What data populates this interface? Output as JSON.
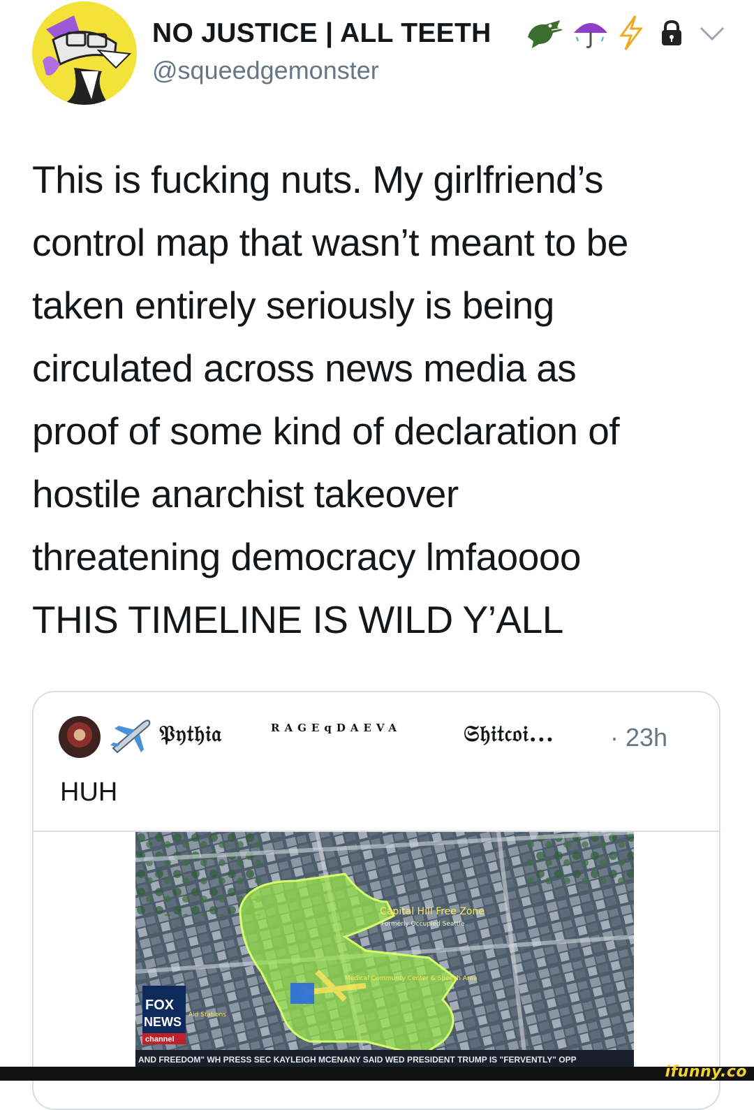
{
  "header": {
    "display_name": "NO JUSTICE | ALL TEETH",
    "name_emojis": [
      "crocodile-emoji",
      "umbrella-emoji",
      "lightning-emoji"
    ],
    "handle": "@squeedgemonster",
    "icons": [
      "lock-icon",
      "chevron-down-icon"
    ]
  },
  "tweet": {
    "text": "This is fucking nuts. My girlfriend’s\ncontrol map that wasn’t meant to be\ntaken entirely seriously is being\ncirculated across news media as\nproof of some kind of declaration of\nhostile anarchist takeover\nthreatening democracy lmfaoooo\nTHIS TIMELINE IS WILD Y’ALL"
  },
  "quoted_tweet": {
    "name_part1": "𝔓𝔶𝔱𝔥𝔦𝔞",
    "name_small": "RAGEqDAEVA",
    "name_part2": "𝔖𝔥𝔦𝔱𝔠𝔬𝔦...",
    "time": "· 23h",
    "text": "HUH",
    "media": {
      "labels": {
        "zone": "Capital Hill Free Zone",
        "zone_sub": "Formerly Occupied Seattle",
        "area_label": "Medical Communty Center & Speech Area",
        "network": "FOX",
        "network2": "NEWS",
        "channel": "channel",
        "stations": "Aid Stations",
        "ticker": "AND FREEDOM\"     WH PRESS SEC KAYLEIGH MCENANY SAID WED PRESIDENT TRUMP IS \"FERVENTLY\" OPP"
      }
    }
  },
  "watermark": "ifunny.co",
  "colors": {
    "avatar_bg": "#f3e23a",
    "handle_gray": "#657786",
    "zone_green": "#9be84a",
    "watermark_yellow": "#f2d42c"
  }
}
